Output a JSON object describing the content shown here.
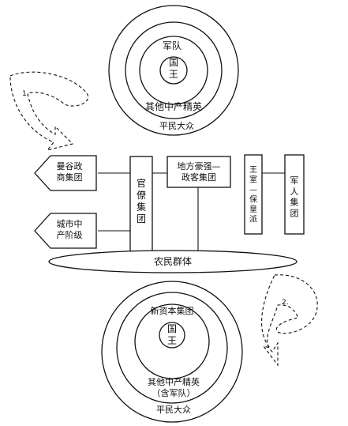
{
  "top_circle": {
    "center_label": "国\n王",
    "ring1_label": "军队",
    "ring2_label": "其他中产精英",
    "ring3_label": "平民大众"
  },
  "middle": {
    "diamond_left_top": "曼谷政\n商集团",
    "diamond_left_bottom": "城市中\n产阶级",
    "box_bureaucrat": "官\n僚\n集\n团",
    "box_local": "地方豪强—\n政客集团",
    "box_royalist": "王\n室\n—\n保\n皇\n派",
    "box_military": "军\n人\n集\n团",
    "ellipse_farmers": "农民群体"
  },
  "bottom_circle": {
    "center_label": "国\n王",
    "ring1_label": "新资本集团",
    "ring2_label": "其他中产精英\n（含军队）",
    "ring3_label": "平民大众"
  },
  "arrows": {
    "arrow1_label": "1.",
    "arrow2_label": "2."
  }
}
